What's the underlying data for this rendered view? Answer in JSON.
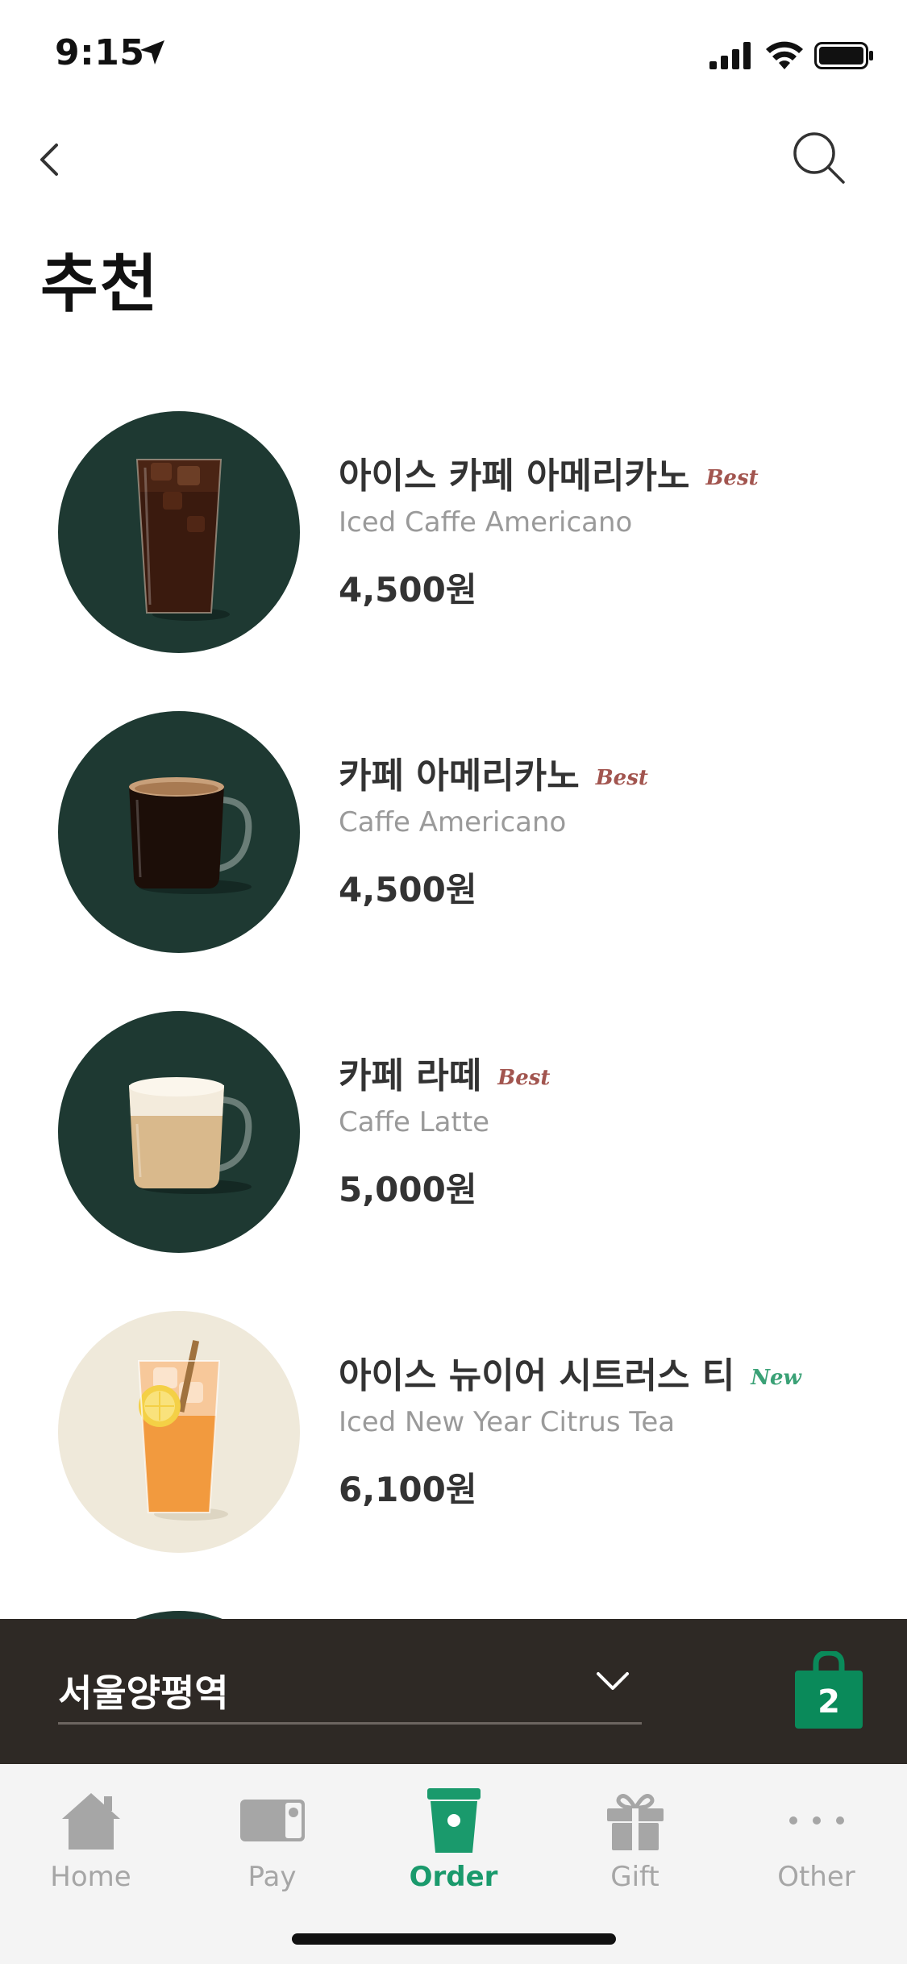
{
  "status_bar": {
    "time": "9:15"
  },
  "header": {
    "title": "추천"
  },
  "menu": {
    "items": [
      {
        "name_ko": "아이스 카페 아메리카노",
        "badge": "Best",
        "name_en": "Iced Caffe Americano",
        "price": "4,500원"
      },
      {
        "name_ko": "카페 아메리카노",
        "badge": "Best",
        "name_en": "Caffe Americano",
        "price": "4,500원"
      },
      {
        "name_ko": "카페 라떼",
        "badge": "Best",
        "name_en": "Caffe Latte",
        "price": "5,000원"
      },
      {
        "name_ko": "아이스 뉴이어 시트러스 티",
        "badge": "New",
        "name_en": "Iced New Year Citrus Tea",
        "price": "6,100원"
      }
    ]
  },
  "store_bar": {
    "store_name": "서울양평역",
    "cart_count": "2"
  },
  "tab_bar": {
    "tabs": [
      {
        "label": "Home",
        "icon": "home-icon"
      },
      {
        "label": "Pay",
        "icon": "card-icon"
      },
      {
        "label": "Order",
        "icon": "cup-icon"
      },
      {
        "label": "Gift",
        "icon": "gift-icon"
      },
      {
        "label": "Other",
        "icon": "more-icon"
      }
    ],
    "active": "Order"
  },
  "colors": {
    "dark_green": "#1e3932",
    "cream": "#efe9da",
    "accent_green": "#1a9a6c",
    "store_bar": "#2e2925",
    "best_badge": "#a2554f",
    "new_badge": "#3aa176"
  }
}
